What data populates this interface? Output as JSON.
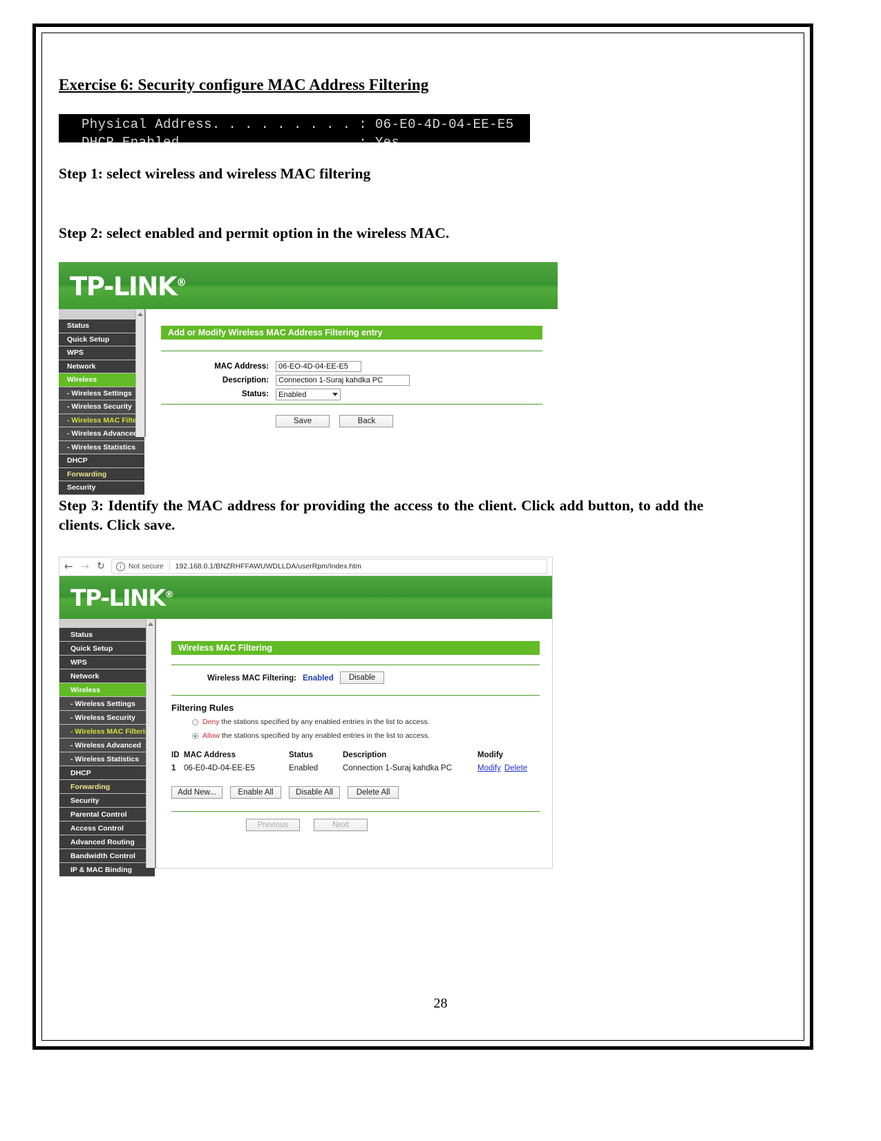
{
  "document": {
    "exercise_title": "Exercise 6: Security configure MAC Address Filtering",
    "page_number": "28",
    "cmd_output_line1": "Physical Address. . . . . . . . . : 06-E0-4D-04-EE-E5",
    "cmd_output_line2": "DHCP Enabled. . . . . . . . . . . : Yes",
    "step1": "Step 1: select wireless and wireless MAC filtering",
    "step2": "Step 2: select enabled and permit option in the wireless MAC.",
    "step3": "Step 3: Identify the MAC address for providing the access to the client. Click add button, to add the clients. Click save."
  },
  "screenshot1": {
    "brand": "TP-LINK",
    "brand_mark": "®",
    "sidebar": [
      {
        "label": "Status",
        "type": "top"
      },
      {
        "label": "Quick Setup",
        "type": "top"
      },
      {
        "label": "WPS",
        "type": "top"
      },
      {
        "label": "Network",
        "type": "top"
      },
      {
        "label": "Wireless",
        "type": "active"
      },
      {
        "label": "- Wireless Settings",
        "type": "sub"
      },
      {
        "label": "- Wireless Security",
        "type": "sub"
      },
      {
        "label": "- Wireless MAC Filtering",
        "type": "current"
      },
      {
        "label": "- Wireless Advanced",
        "type": "sub"
      },
      {
        "label": "- Wireless Statistics",
        "type": "sub"
      },
      {
        "label": "DHCP",
        "type": "top"
      },
      {
        "label": "Forwarding",
        "type": "forwarding"
      },
      {
        "label": "Security",
        "type": "top"
      }
    ],
    "panel_title": "Add or Modify Wireless MAC Address Filtering entry",
    "fields": {
      "mac_label": "MAC Address:",
      "mac_value": "06-EO-4D-04-EE-E5",
      "desc_label": "Description:",
      "desc_value": "Connection 1-Suraj kahdka PC",
      "status_label": "Status:",
      "status_value": "Enabled"
    },
    "buttons": {
      "save": "Save",
      "back": "Back"
    }
  },
  "screenshot2": {
    "browser": {
      "back_icon": "back-arrow-icon",
      "forward_icon": "forward-arrow-icon",
      "reload_icon": "reload-icon",
      "security_label": "Not secure",
      "url": "192.168.0.1/BNZRHFFAWUWDLLDA/userRpm/Index.htm"
    },
    "brand": "TP-LINK",
    "brand_mark": "®",
    "sidebar": [
      {
        "label": "Status",
        "type": "top"
      },
      {
        "label": "Quick Setup",
        "type": "top"
      },
      {
        "label": "WPS",
        "type": "top"
      },
      {
        "label": "Network",
        "type": "top"
      },
      {
        "label": "Wireless",
        "type": "active"
      },
      {
        "label": "- Wireless Settings",
        "type": "sub"
      },
      {
        "label": "- Wireless Security",
        "type": "sub"
      },
      {
        "label": "- Wireless MAC Filtering",
        "type": "current"
      },
      {
        "label": "- Wireless Advanced",
        "type": "sub"
      },
      {
        "label": "- Wireless Statistics",
        "type": "sub"
      },
      {
        "label": "DHCP",
        "type": "top"
      },
      {
        "label": "Forwarding",
        "type": "forwarding"
      },
      {
        "label": "Security",
        "type": "top"
      },
      {
        "label": "Parental Control",
        "type": "top"
      },
      {
        "label": "Access Control",
        "type": "top"
      },
      {
        "label": "Advanced Routing",
        "type": "top"
      },
      {
        "label": "Bandwidth Control",
        "type": "top"
      },
      {
        "label": "IP & MAC Binding",
        "type": "top"
      }
    ],
    "panel_title": "Wireless MAC Filtering",
    "status_row": {
      "label": "Wireless MAC Filtering:",
      "value": "Enabled",
      "toggle_button": "Disable"
    },
    "filtering_rules": {
      "heading": "Filtering Rules",
      "options": [
        {
          "keyword": "Deny",
          "text": " the stations specified by any enabled entries in the list to access.",
          "selected": false
        },
        {
          "keyword": "Allow",
          "text": " the stations specified by any enabled entries in the list to access.",
          "selected": true
        }
      ]
    },
    "table": {
      "headers": [
        "ID",
        "MAC Address",
        "Status",
        "Description",
        "Modify"
      ],
      "rows": [
        {
          "id": "1",
          "mac": "06-E0-4D-04-EE-E5",
          "status": "Enabled",
          "description": "Connection 1-Suraj kahdka PC",
          "modify": "Modify",
          "delete": "Delete"
        }
      ]
    },
    "action_buttons": [
      "Add New...",
      "Enable All",
      "Disable All",
      "Delete All"
    ],
    "pager_buttons": [
      "Previous",
      "Next"
    ]
  },
  "colors": {
    "tp_green": "#62bb26",
    "header_green": "#2f8f27",
    "sidebar_dark": "#3c3c3c",
    "sidebar_sub": "#4a4a4a",
    "current_yellow": "#d3e03a",
    "link_blue": "#2130cf",
    "deny_red": "#cc2a2a"
  }
}
